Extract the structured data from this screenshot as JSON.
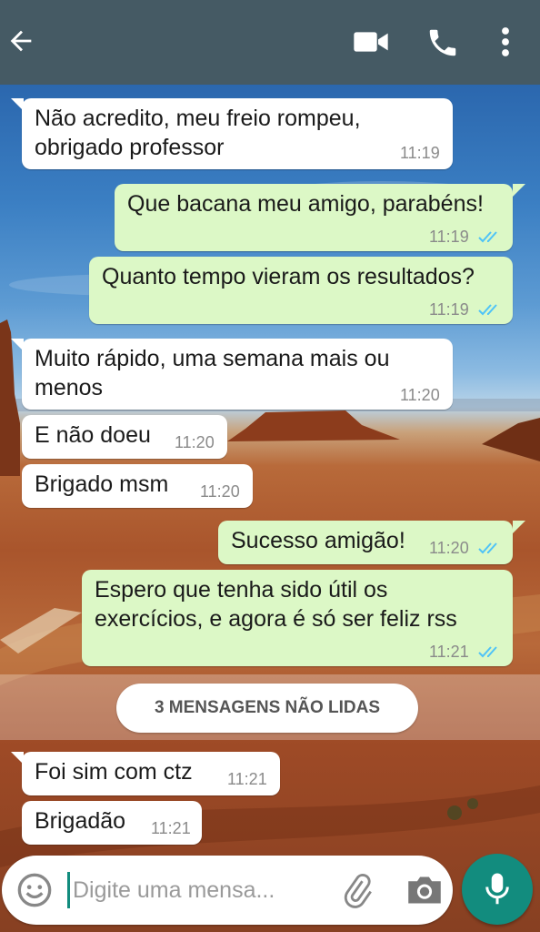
{
  "header": {
    "back_icon": "arrow-left-icon",
    "video_icon": "video-camera-icon",
    "call_icon": "phone-icon",
    "menu_icon": "more-vertical-icon",
    "color": "#455a64"
  },
  "messages": [
    {
      "dir": "in",
      "lines": [
        "Não acredito, meu freio rompeu,",
        "obrigado professor"
      ],
      "time": "11:19"
    },
    {
      "dir": "out",
      "lines": [
        "Que bacana meu amigo, parabéns!"
      ],
      "time": "11:19",
      "read": true
    },
    {
      "dir": "out",
      "lines": [
        "Quanto tempo vieram os resultados?"
      ],
      "time": "11:19",
      "read": true
    },
    {
      "dir": "in",
      "lines": [
        "Muito rápido, uma semana mais ou",
        "menos"
      ],
      "time": "11:20"
    },
    {
      "dir": "in",
      "lines": [
        "E não doeu"
      ],
      "time": "11:20"
    },
    {
      "dir": "in",
      "lines": [
        "Brigado msm"
      ],
      "time": "11:20"
    },
    {
      "dir": "out",
      "lines": [
        "Sucesso amigão!"
      ],
      "time": "11:20",
      "read": true
    },
    {
      "dir": "out",
      "lines": [
        "Espero que tenha sido útil os",
        "exercícios, e agora é só ser feliz rss"
      ],
      "time": "11:21",
      "read": true
    },
    {
      "dir": "in",
      "lines": [
        "Foi sim com ctz"
      ],
      "time": "11:21"
    },
    {
      "dir": "in",
      "lines": [
        "Brigadão"
      ],
      "time": "11:21"
    }
  ],
  "unread_banner": "3 MENSAGENS NÃO LIDAS",
  "composer": {
    "placeholder": "Digite uma mensa...",
    "emoji_icon": "emoji-icon",
    "attach_icon": "paperclip-icon",
    "camera_icon": "camera-icon",
    "mic_icon": "microphone-icon"
  },
  "colors": {
    "incoming": "#ffffff",
    "outgoing": "#dcf8c6",
    "read_tick": "#4fc3f7",
    "accent": "#128c7e"
  }
}
